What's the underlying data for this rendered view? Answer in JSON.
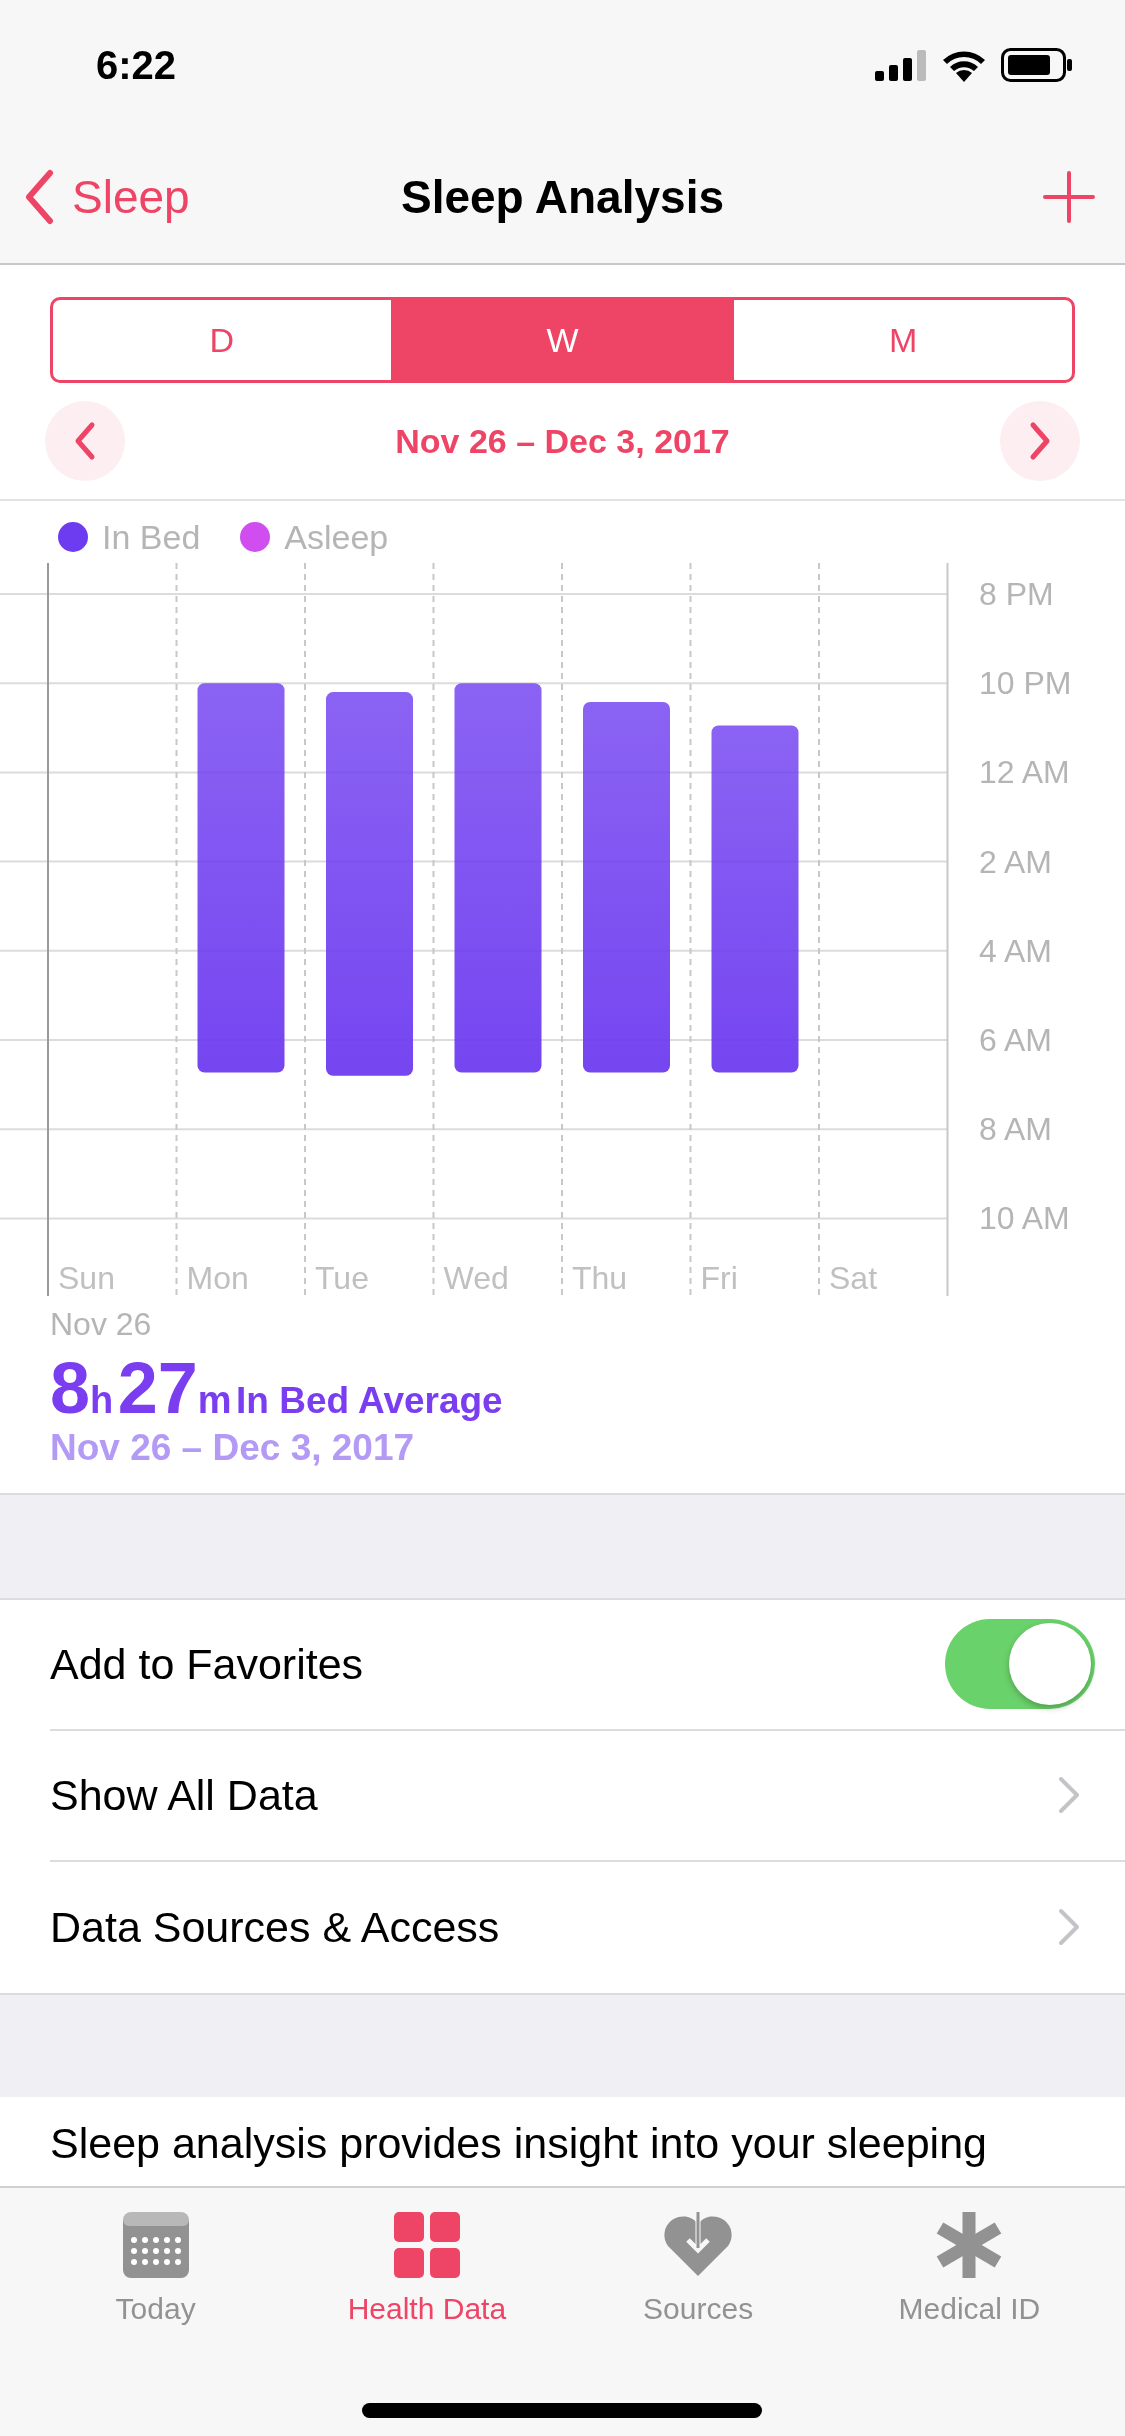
{
  "status_bar": {
    "time": "6:22"
  },
  "nav": {
    "back": "Sleep",
    "title": "Sleep Analysis"
  },
  "segments": [
    {
      "label": "D",
      "selected": false
    },
    {
      "label": "W",
      "selected": true
    },
    {
      "label": "M",
      "selected": false
    }
  ],
  "date_range": "Nov 26 – Dec 3, 2017",
  "legend": [
    {
      "label": "In Bed",
      "color": "#6e3cf0"
    },
    {
      "label": "Asleep",
      "color": "#d04ef0"
    }
  ],
  "chart": {
    "day_labels": [
      "Sun",
      "Mon",
      "Tue",
      "Wed",
      "Thu",
      "Fri",
      "Sat"
    ],
    "time_labels": [
      "8 PM",
      "10 PM",
      "12 AM",
      "2 AM",
      "4 AM",
      "6 AM",
      "8 AM",
      "10 AM"
    ]
  },
  "chart_start_label": "Nov 26",
  "summary": {
    "hours": "8",
    "hours_unit": "h",
    "minutes": "27",
    "minutes_unit": "m",
    "caption": "In Bed Average",
    "range": "Nov 26 – Dec 3, 2017"
  },
  "rows": [
    {
      "kind": "toggle",
      "label": "Add to Favorites",
      "on": true
    },
    {
      "kind": "link",
      "label": "Show All Data"
    },
    {
      "kind": "link",
      "label": "Data Sources & Access"
    }
  ],
  "description": "Sleep analysis provides insight into your sleeping",
  "tab_bar": [
    {
      "label": "Today",
      "selected": false
    },
    {
      "label": "Health Data",
      "selected": true
    },
    {
      "label": "Sources",
      "selected": false
    },
    {
      "label": "Medical ID",
      "selected": false
    }
  ]
}
